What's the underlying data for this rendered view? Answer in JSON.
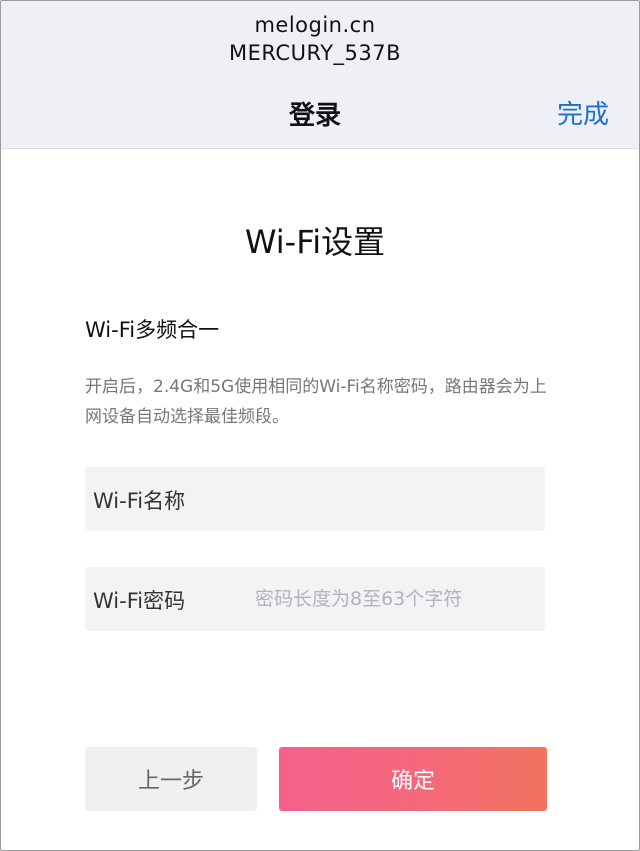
{
  "browser": {
    "url": "melogin.cn",
    "ssid": "MERCURY_537B"
  },
  "nav": {
    "title": "登录",
    "done_label": "完成"
  },
  "main": {
    "title": "Wi-Fi设置",
    "section_title": "Wi-Fi多频合一",
    "description": "开启后，2.4G和5G使用相同的Wi-Fi名称密码，路由器会为上网设备自动选择最佳频段。",
    "wifi_name": {
      "label": "Wi-Fi名称",
      "value": "",
      "placeholder": ""
    },
    "wifi_password": {
      "label": "Wi-Fi密码",
      "value": "",
      "placeholder": "密码长度为8至63个字符"
    }
  },
  "buttons": {
    "prev_label": "上一步",
    "ok_label": "确定"
  },
  "colors": {
    "accent_blue": "#1a6fd6",
    "ok_gradient_start": "#f5608c",
    "ok_gradient_end": "#f2735e",
    "topbar_bg": "#eef0f6"
  }
}
